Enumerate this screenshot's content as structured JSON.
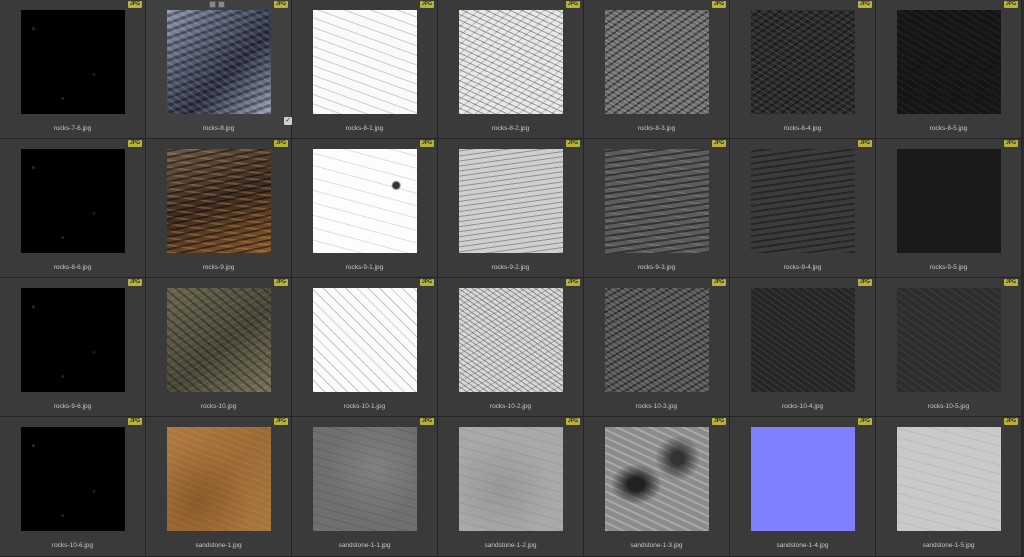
{
  "badge_text": "JPG",
  "selected_index": 1,
  "hover_icons": [
    "image-icon",
    "edit-icon"
  ],
  "items": [
    {
      "name": "rocks-7-6.jpg",
      "texture": "t-speck"
    },
    {
      "name": "rocks-8.jpg",
      "texture": "t-rockblue"
    },
    {
      "name": "rocks-8-1.jpg",
      "texture": "t-white-line"
    },
    {
      "name": "rocks-8-2.jpg",
      "texture": "t-white-detail"
    },
    {
      "name": "rocks-8-3.jpg",
      "texture": "t-gray-rough"
    },
    {
      "name": "rocks-8-4.jpg",
      "texture": "t-dark-rough"
    },
    {
      "name": "rocks-8-5.jpg",
      "texture": "t-darker"
    },
    {
      "name": "rocks-8-6.jpg",
      "texture": "t-speck"
    },
    {
      "name": "rocks-9.jpg",
      "texture": "t-rockbrown"
    },
    {
      "name": "rocks-9-1.jpg",
      "texture": "t-white-sparse"
    },
    {
      "name": "rocks-9-2.jpg",
      "texture": "t-light-layers"
    },
    {
      "name": "rocks-9-3.jpg",
      "texture": "t-mid-layers"
    },
    {
      "name": "rocks-9-4.jpg",
      "texture": "t-dark-layers"
    },
    {
      "name": "rocks-9-5.jpg",
      "texture": "t-verydark"
    },
    {
      "name": "rocks-9-6.jpg",
      "texture": "t-speck"
    },
    {
      "name": "rocks-10.jpg",
      "texture": "t-rockgreen"
    },
    {
      "name": "rocks-10-1.jpg",
      "texture": "t-white-cracks"
    },
    {
      "name": "rocks-10-2.jpg",
      "texture": "t-light-rough"
    },
    {
      "name": "rocks-10-3.jpg",
      "texture": "t-mid-rough"
    },
    {
      "name": "rocks-10-4.jpg",
      "texture": "t-dark-rough2"
    },
    {
      "name": "rocks-10-5.jpg",
      "texture": "t-dark-rough3"
    },
    {
      "name": "rocks-10-6.jpg",
      "texture": "t-speck"
    },
    {
      "name": "sandstone-1.jpg",
      "texture": "t-sand"
    },
    {
      "name": "sandstone-1-1.jpg",
      "texture": "t-sand-gray"
    },
    {
      "name": "sandstone-1-2.jpg",
      "texture": "t-sand-light"
    },
    {
      "name": "sandstone-1-3.jpg",
      "texture": "t-sand-contrast"
    },
    {
      "name": "sandstone-1-4.jpg",
      "texture": "t-normal"
    },
    {
      "name": "sandstone-1-5.jpg",
      "texture": "t-sand-pale"
    }
  ]
}
